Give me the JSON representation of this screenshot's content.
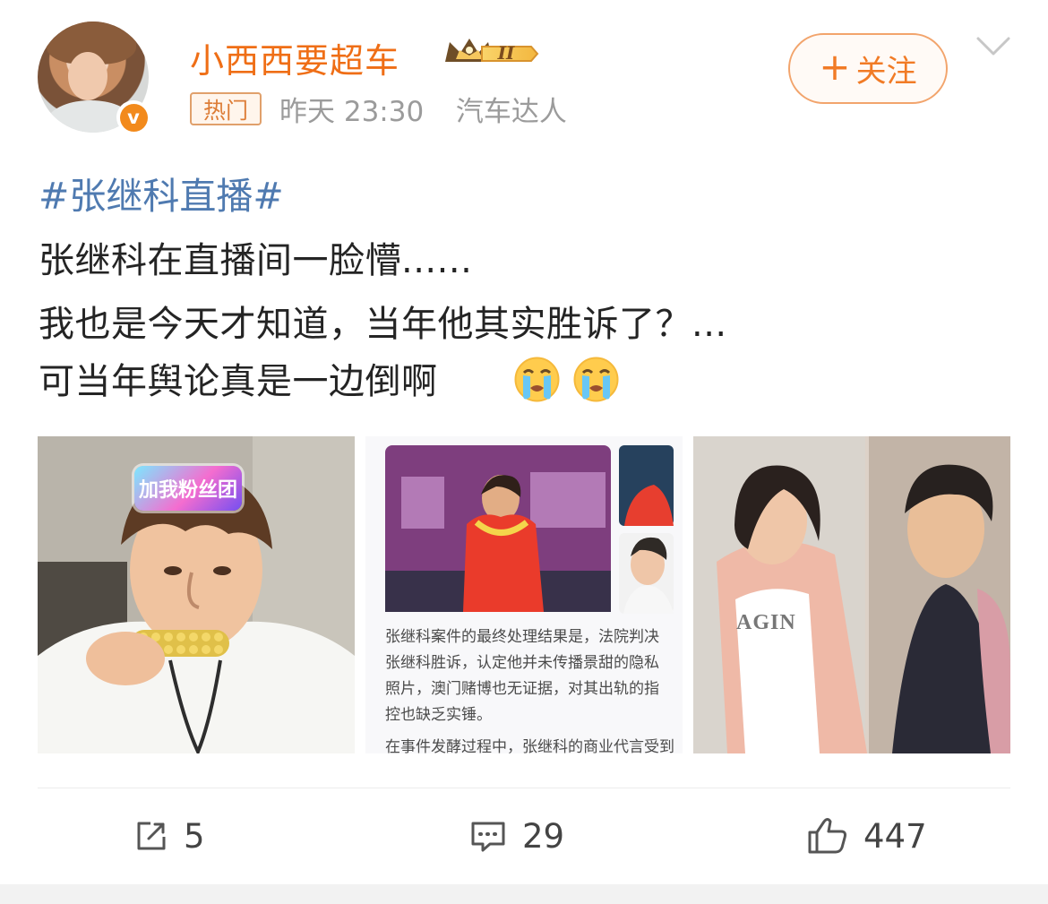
{
  "author": {
    "name": "小西西要超车",
    "level_badge": "II",
    "hot_tag": "热门",
    "meta_time": "昨天 23:30",
    "meta_source": "汽车达人",
    "verified_mark": "v"
  },
  "follow": {
    "plus": "+",
    "label": "关注"
  },
  "post": {
    "topic": "#张继科直播#",
    "lines": [
      "张继科在直播间一脸懵......",
      "我也是今天才知道，当年他其实胜诉了？...",
      "可当年舆论真是一边倒啊"
    ],
    "emoji": [
      "crying-face-emoji",
      "crying-face-emoji"
    ]
  },
  "media": {
    "image_1_badge": "加我粉丝团",
    "image_2_caption": "张继科案件的最终处理结果是，法院判决张继科胜诉，认定他并未传播景甜的隐私照片，澳门赌博也无证据，对其出轨的指控也缺乏实锤。",
    "image_2_caption_2": "在事件发酵过程中，张继科的商业代言受到",
    "image_3_shirt": "AGIN"
  },
  "actions": {
    "repost": "5",
    "comment": "29",
    "like": "447"
  },
  "colors": {
    "accent": "#ef6e16",
    "topic": "#4f7ab0",
    "hot_border": "#e0a06b"
  }
}
